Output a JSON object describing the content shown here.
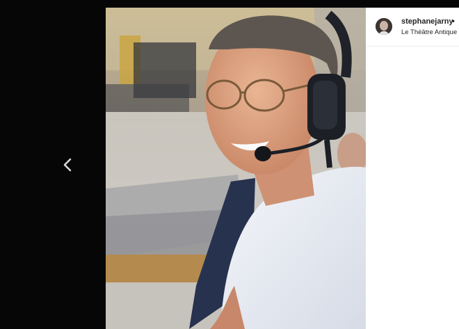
{
  "post": {
    "username": "stephanejarny",
    "separator": "•",
    "location": "Le Théâtre Antique d"
  },
  "icons": {
    "prev": "chevron-left-icon",
    "avatar": "profile-avatar"
  }
}
